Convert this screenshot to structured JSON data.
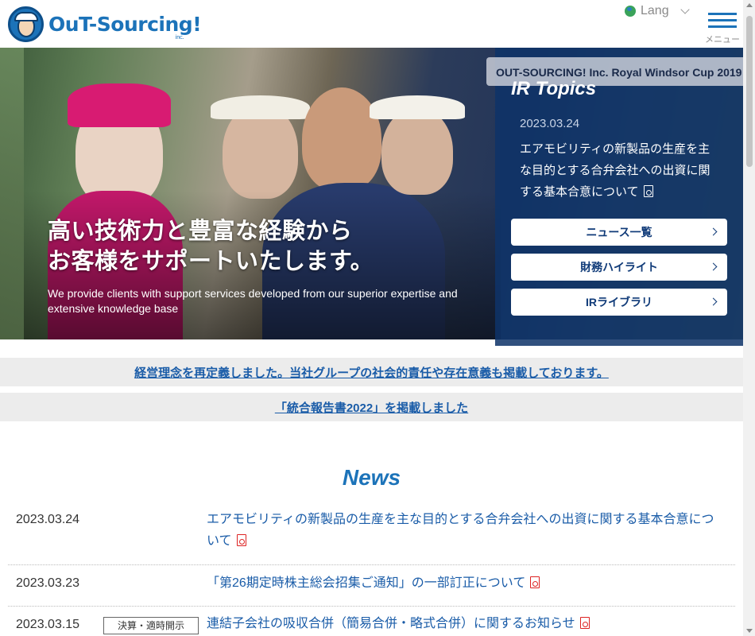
{
  "header": {
    "logo_text": "OuT-Sourcing!",
    "logo_inc": "inc.",
    "lang_label": "Lang",
    "menu_label": "メニュー"
  },
  "hero": {
    "title_line1": "高い技術力と豊富な経験から",
    "title_line2": "お客様をサポートいたします。",
    "subtitle": "We provide clients with support services developed from our superior expertise and extensive knowledge base"
  },
  "ir": {
    "banner": "OUT-SOURCING! Inc. Royal Windsor Cup  2019",
    "title": "IR Topics",
    "date": "2023.03.24",
    "text": "エアモビリティの新製品の生産を主な目的とする合弁会社への出資に関する基本合意について",
    "buttons": [
      "ニュース一覧",
      "財務ハイライト",
      "IRライブラリ"
    ]
  },
  "notices": [
    "経営理念を再定義しました。当社グループの社会的責任や存在意義も掲載しております。",
    "「統合報告書2022」を掲載しました"
  ],
  "news": {
    "title": "News",
    "items": [
      {
        "date": "2023.03.24",
        "badge": "",
        "text": "エアモビリティの新製品の生産を主な目的とする合弁会社への出資に関する基本合意について"
      },
      {
        "date": "2023.03.23",
        "badge": "",
        "text": "「第26期定時株主総会招集ご通知」の一部訂正について"
      },
      {
        "date": "2023.03.15",
        "badge": "決算・適時開示",
        "text": "連結子会社の吸収合併（簡易合併・略式合併）に関するお知らせ"
      }
    ]
  },
  "colors": {
    "brand_blue": "#1c73b9",
    "ir_panel": "#0e3369",
    "link": "#1a5ca8",
    "pdf_red": "#dd2222"
  }
}
